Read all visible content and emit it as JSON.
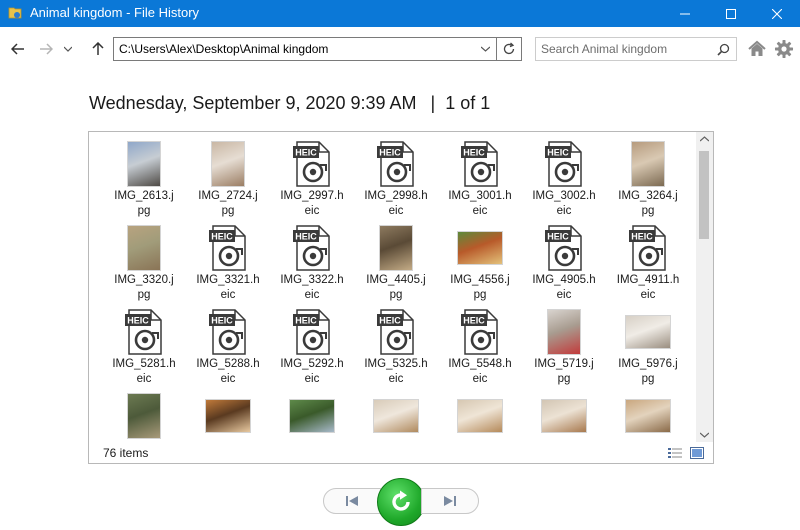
{
  "window": {
    "title": "Animal kingdom - File History",
    "accent_color": "#0b78d7"
  },
  "nav": {
    "address_path": "C:\\Users\\Alex\\Desktop\\Animal kingdom",
    "search_placeholder": "Search Animal kingdom"
  },
  "header": {
    "date": "Wednesday, September 9, 2020 9:39 AM",
    "separator": "|",
    "page": "1 of 1"
  },
  "items": [
    {
      "name": "IMG_2613.jpg",
      "line1": "IMG_2613.j",
      "line2": "pg",
      "kind": "photo",
      "colors": [
        "#8fa7c9",
        "#4e4a45",
        "#c7cdd3"
      ]
    },
    {
      "name": "IMG_2724.jpg",
      "line1": "IMG_2724.j",
      "line2": "pg",
      "kind": "photo",
      "colors": [
        "#c9b7a4",
        "#9b7e64",
        "#e6ddd3"
      ]
    },
    {
      "name": "IMG_2997.heic",
      "line1": "IMG_2997.h",
      "line2": "eic",
      "kind": "heic"
    },
    {
      "name": "IMG_2998.heic",
      "line1": "IMG_2998.h",
      "line2": "eic",
      "kind": "heic"
    },
    {
      "name": "IMG_3001.heic",
      "line1": "IMG_3001.h",
      "line2": "eic",
      "kind": "heic"
    },
    {
      "name": "IMG_3002.heic",
      "line1": "IMG_3002.h",
      "line2": "eic",
      "kind": "heic"
    },
    {
      "name": "IMG_3264.jpg",
      "line1": "IMG_3264.j",
      "line2": "pg",
      "kind": "photo",
      "colors": [
        "#b69b7e",
        "#7c6a52",
        "#d9c9b3"
      ]
    },
    {
      "name": "IMG_3320.jpg",
      "line1": "IMG_3320.j",
      "line2": "pg",
      "kind": "photo",
      "colors": [
        "#b8a37f",
        "#8a7456",
        "#a19c7a"
      ]
    },
    {
      "name": "IMG_3321.heic",
      "line1": "IMG_3321.h",
      "line2": "eic",
      "kind": "heic"
    },
    {
      "name": "IMG_3322.heic",
      "line1": "IMG_3322.h",
      "line2": "eic",
      "kind": "heic"
    },
    {
      "name": "IMG_4405.jpg",
      "line1": "IMG_4405.j",
      "line2": "pg",
      "kind": "photo",
      "colors": [
        "#8d7a5f",
        "#c3ab86",
        "#5a4a36"
      ]
    },
    {
      "name": "IMG_4556.jpg",
      "line1": "IMG_4556.j",
      "line2": "pg",
      "kind": "photo-wide",
      "colors": [
        "#5d8a3a",
        "#e3c17a",
        "#b85a2a"
      ]
    },
    {
      "name": "IMG_4905.heic",
      "line1": "IMG_4905.h",
      "line2": "eic",
      "kind": "heic"
    },
    {
      "name": "IMG_4911.heic",
      "line1": "IMG_4911.h",
      "line2": "eic",
      "kind": "heic"
    },
    {
      "name": "IMG_5281.heic",
      "line1": "IMG_5281.h",
      "line2": "eic",
      "kind": "heic"
    },
    {
      "name": "IMG_5288.heic",
      "line1": "IMG_5288.h",
      "line2": "eic",
      "kind": "heic"
    },
    {
      "name": "IMG_5292.heic",
      "line1": "IMG_5292.h",
      "line2": "eic",
      "kind": "heic"
    },
    {
      "name": "IMG_5325.heic",
      "line1": "IMG_5325.h",
      "line2": "eic",
      "kind": "heic"
    },
    {
      "name": "IMG_5548.heic",
      "line1": "IMG_5548.h",
      "line2": "eic",
      "kind": "heic"
    },
    {
      "name": "IMG_5719.jpg",
      "line1": "IMG_5719.j",
      "line2": "pg",
      "kind": "photo",
      "colors": [
        "#d9d4cf",
        "#c23b3b",
        "#a89c90"
      ]
    },
    {
      "name": "IMG_5976.jpg",
      "line1": "IMG_5976.j",
      "line2": "pg",
      "kind": "photo-wide",
      "colors": [
        "#d7d0c6",
        "#9a8e80",
        "#f0ece6"
      ]
    },
    {
      "name": "",
      "line1": "",
      "line2": "",
      "kind": "photo",
      "colors": [
        "#6c7a52",
        "#a89a7a",
        "#4d5a3a"
      ]
    },
    {
      "name": "",
      "line1": "",
      "line2": "",
      "kind": "photo-wide",
      "colors": [
        "#c07a3a",
        "#e8c9a0",
        "#5a3a20"
      ]
    },
    {
      "name": "",
      "line1": "",
      "line2": "",
      "kind": "photo-wide",
      "colors": [
        "#5e8a4a",
        "#a7b9c9",
        "#3a5a2a"
      ]
    },
    {
      "name": "",
      "line1": "",
      "line2": "",
      "kind": "photo-wide",
      "colors": [
        "#d8cbb9",
        "#b08a5e",
        "#efe7dc"
      ]
    },
    {
      "name": "",
      "line1": "",
      "line2": "",
      "kind": "photo-wide",
      "colors": [
        "#d6c7b2",
        "#b58a5a",
        "#efe5d6"
      ]
    },
    {
      "name": "",
      "line1": "",
      "line2": "",
      "kind": "photo-wide",
      "colors": [
        "#d2c5b3",
        "#a8794e",
        "#ece2d4"
      ]
    },
    {
      "name": "",
      "line1": "",
      "line2": "",
      "kind": "photo-wide",
      "colors": [
        "#c9a77f",
        "#8a6a48",
        "#e3d3bd"
      ]
    }
  ],
  "status": {
    "item_count": "76 items"
  },
  "controls": {
    "restore_color": "#1fa82a"
  }
}
